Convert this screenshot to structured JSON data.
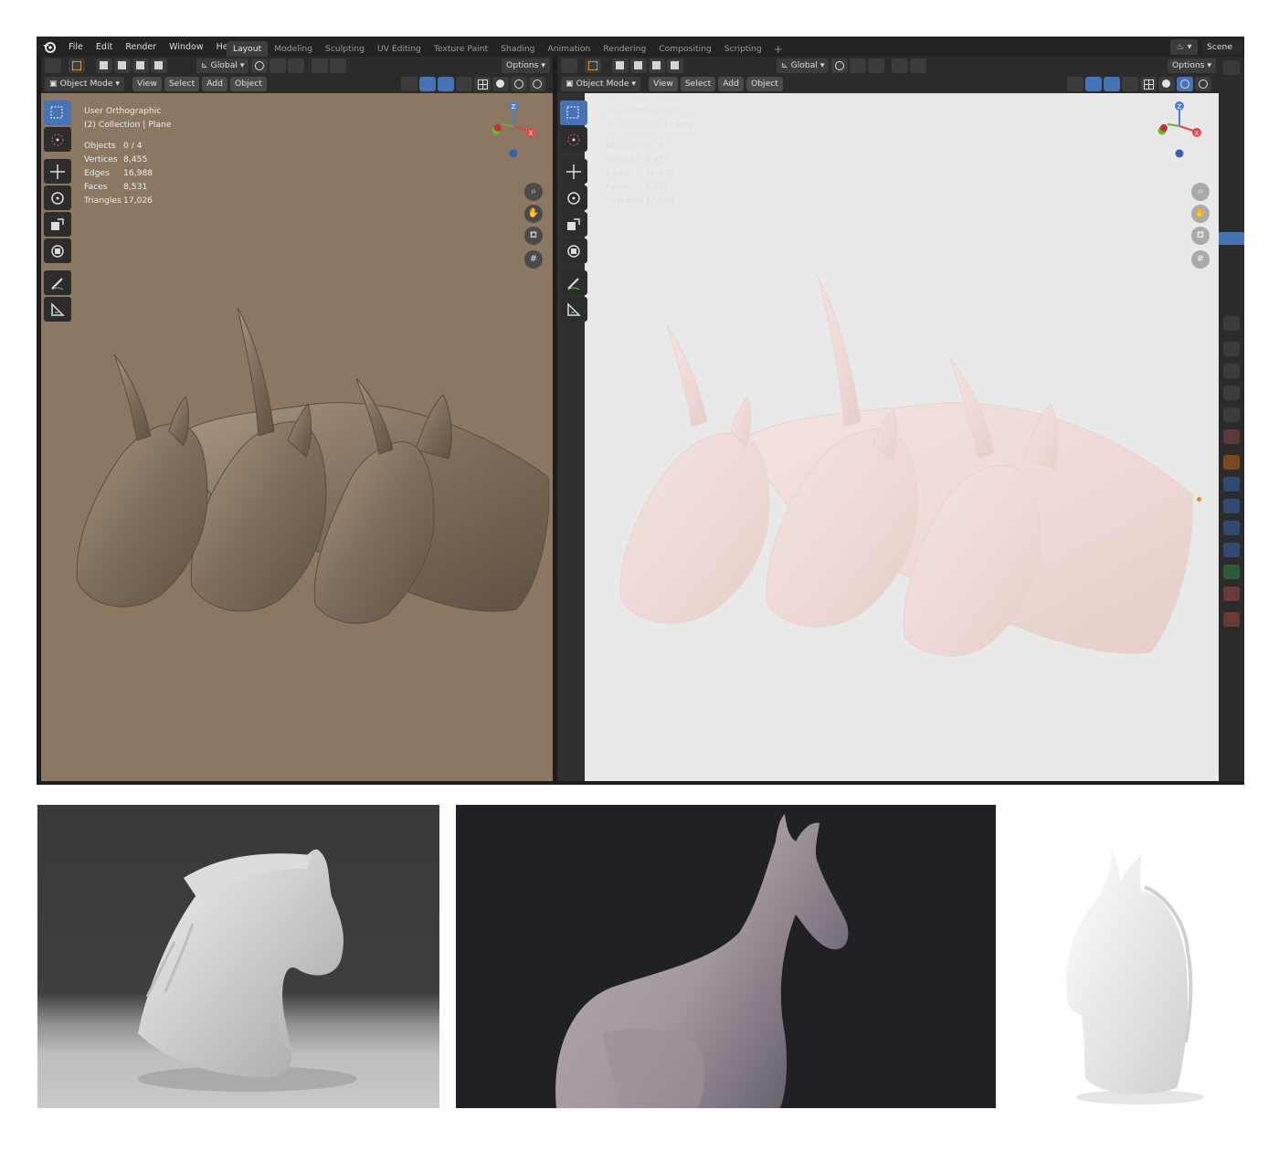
{
  "app": {
    "menu": [
      "File",
      "Edit",
      "Render",
      "Window",
      "Help"
    ],
    "workspaces": [
      "Layout",
      "Modeling",
      "Sculpting",
      "UV Editing",
      "Texture Paint",
      "Shading",
      "Animation",
      "Rendering",
      "Compositing",
      "Scripting"
    ],
    "active_workspace": "Layout",
    "scene_name": "Scene"
  },
  "colors": {
    "accent_blue": "#4772b3",
    "left_viewport_bg": "#8c7762",
    "right_viewport_bg": "#e9e9ea",
    "unicorn_left": "#8a7966",
    "unicorn_right": "#f1dcd9"
  },
  "viewport_left": {
    "header": {
      "orientation": "Global",
      "options": "Options"
    },
    "header2": {
      "mode": "Object Mode",
      "menus": [
        "View",
        "Select",
        "Add",
        "Object"
      ]
    },
    "overlay": {
      "view_name": "User Orthographic",
      "collection": "(2) Collection | Plane",
      "stats": [
        {
          "label": "Objects",
          "value": "0 / 4"
        },
        {
          "label": "Vertices",
          "value": "8,455"
        },
        {
          "label": "Edges",
          "value": "16,988"
        },
        {
          "label": "Faces",
          "value": "8,531"
        },
        {
          "label": "Triangles",
          "value": "17,026"
        }
      ]
    }
  },
  "viewport_right": {
    "header": {
      "orientation": "Global",
      "options": "Options"
    },
    "header2": {
      "mode": "Object Mode",
      "menus": [
        "View",
        "Select",
        "Add",
        "Object"
      ]
    },
    "overlay": {
      "view_name": "User Orthographic",
      "collection": "(2) Collection | Plane",
      "stats": [
        {
          "label": "Objects",
          "value": "0 / 4"
        },
        {
          "label": "Vertices",
          "value": "8,455"
        },
        {
          "label": "Edges",
          "value": "16,988"
        },
        {
          "label": "Faces",
          "value": "8,531"
        },
        {
          "label": "Triangles",
          "value": "17,026"
        }
      ]
    }
  },
  "gizmo": {
    "x": "X",
    "y": "Y",
    "z": "Z"
  },
  "icons": {
    "tools": [
      "select-box-icon",
      "cursor-icon",
      "move-icon",
      "rotate-icon",
      "scale-icon",
      "transform-icon",
      "annotate-icon",
      "measure-icon"
    ],
    "nav": [
      "zoom-icon",
      "pan-hand-icon",
      "camera-icon",
      "ortho-grid-icon"
    ],
    "properties": [
      "tool-icon",
      "render-icon",
      "output-icon",
      "view-layer-icon",
      "scene-icon",
      "world-icon",
      "object-icon",
      "modifier-icon",
      "particles-icon",
      "physics-icon",
      "constraints-icon",
      "data-icon",
      "material-icon",
      "texture-icon"
    ]
  },
  "photos": [
    {
      "subject": "horse-bust-with-mane-sculpt"
    },
    {
      "subject": "standing-horse-sculpt"
    },
    {
      "subject": "unicorn-head-statue"
    }
  ]
}
